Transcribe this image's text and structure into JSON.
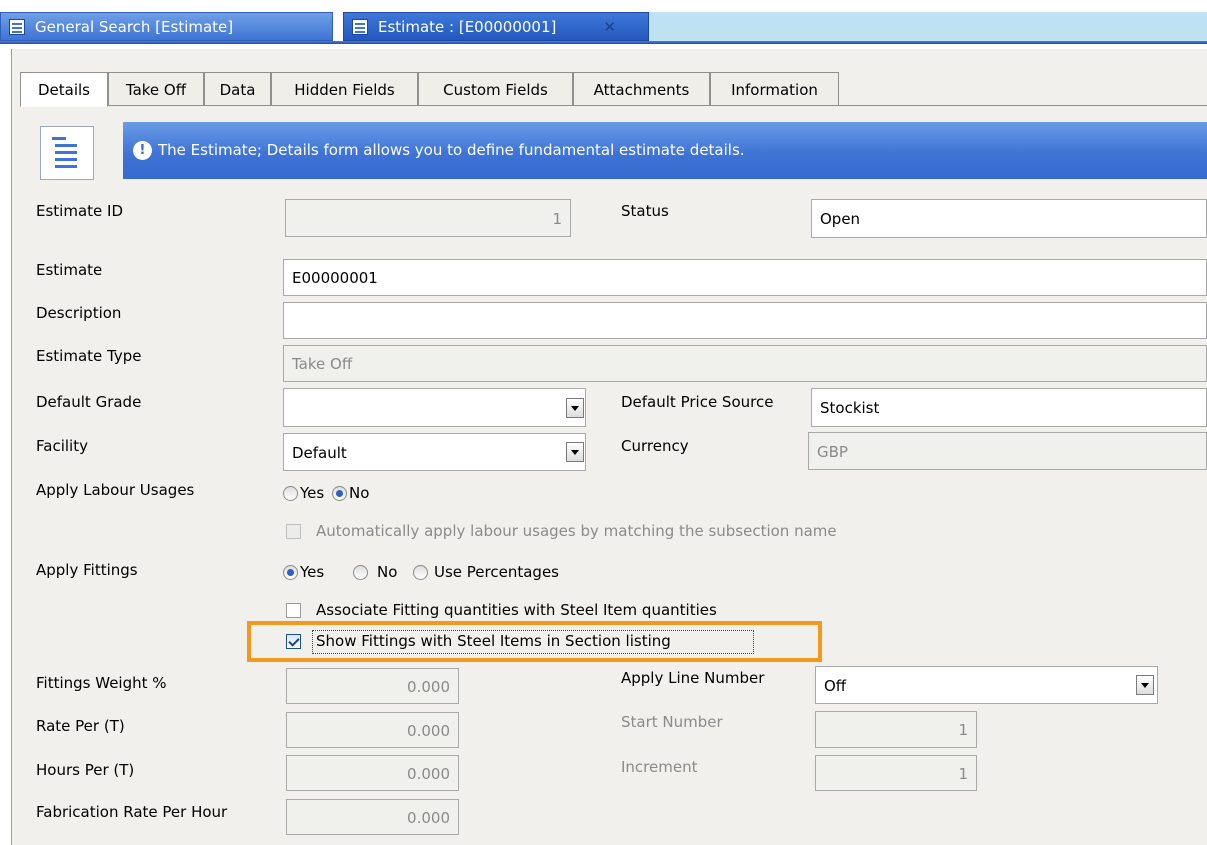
{
  "doc_tabs": {
    "search_label": "General Search [Estimate]",
    "estimate_label": "Estimate : [E00000001]",
    "close_glyph": "✕"
  },
  "subtabs": [
    "Details",
    "Take Off",
    "Data",
    "Hidden Fields",
    "Custom Fields",
    "Attachments",
    "Information"
  ],
  "banner": {
    "info_glyph": "!",
    "text": "The Estimate; Details form allows you to define fundamental estimate details."
  },
  "form": {
    "estimate_id_label": "Estimate ID",
    "estimate_id_value": "1",
    "status_label": "Status",
    "status_value": "Open",
    "estimate_label": "Estimate",
    "estimate_value": "E00000001",
    "description_label": "Description",
    "description_value": "",
    "estimate_type_label": "Estimate Type",
    "estimate_type_value": "Take Off",
    "default_grade_label": "Default Grade",
    "default_grade_value": "",
    "default_price_source_label": "Default Price Source",
    "default_price_source_value": "Stockist",
    "facility_label": "Facility",
    "facility_value": "Default",
    "currency_label": "Currency",
    "currency_value": "GBP",
    "apply_labour_label": "Apply Labour Usages",
    "labour_yes": "Yes",
    "labour_no": "No",
    "auto_labour_text": "Automatically apply labour usages by matching the subsection name",
    "apply_fittings_label": "Apply Fittings",
    "fittings_yes": "Yes",
    "fittings_no": "No",
    "fittings_pct": "Use Percentages",
    "associate_text": "Associate Fitting quantities with Steel Item quantities",
    "show_fittings_text": "Show Fittings with Steel Items in Section listing",
    "fittings_weight_label": "Fittings Weight %",
    "fittings_weight_value": "0.000",
    "apply_line_label": "Apply Line Number",
    "apply_line_value": "Off",
    "rate_per_label": "Rate Per (T)",
    "rate_per_value": "0.000",
    "start_number_label": "Start Number",
    "start_number_value": "1",
    "hours_per_label": "Hours Per (T)",
    "hours_per_value": "0.000",
    "increment_label": "Increment",
    "increment_value": "1",
    "fab_rate_label": "Fabrication Rate Per Hour",
    "fab_rate_value": "0.000"
  }
}
